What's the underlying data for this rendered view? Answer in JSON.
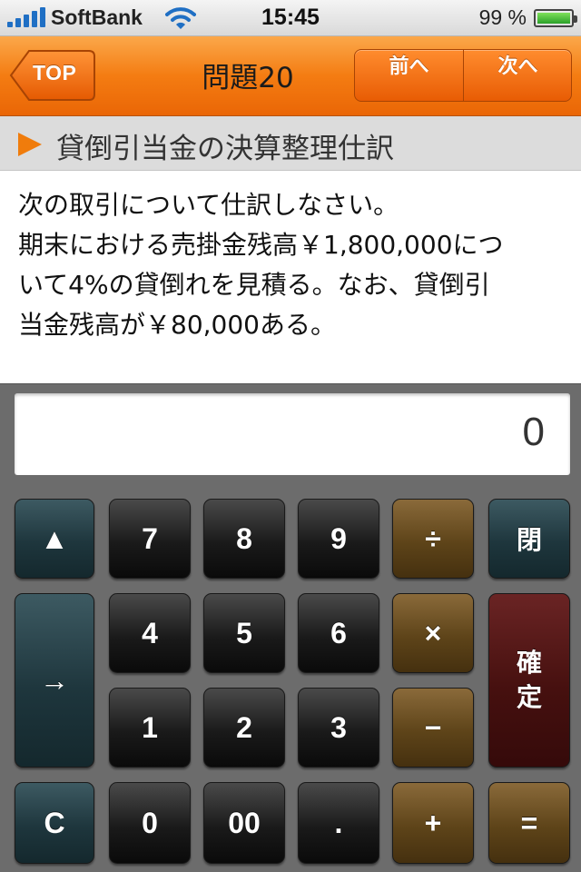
{
  "status_bar": {
    "carrier": "SoftBank",
    "time": "15:45",
    "battery": "99 %",
    "battery_level": 0.99
  },
  "nav": {
    "back_label": "TOP",
    "title": "問題20",
    "prev_label": "前へ",
    "next_label": "次へ"
  },
  "section": {
    "title": "貸倒引当金の決算整理仕訳"
  },
  "question": {
    "lines": [
      "次の取引について仕訳しなさい。",
      "期末における売掛金残高￥1,800,000につ",
      "いて4%の貸倒れを見積る。なお、貸倒引",
      "当金残高が￥80,000ある。"
    ]
  },
  "calculator": {
    "display": "0",
    "keys": {
      "up": "▲",
      "seven": "7",
      "eight": "8",
      "nine": "9",
      "divide": "÷",
      "close": "閉",
      "right": "→",
      "four": "4",
      "five": "5",
      "six": "6",
      "multiply": "×",
      "confirm": "確定",
      "one": "1",
      "two": "2",
      "three": "3",
      "minus": "−",
      "clear": "C",
      "zero": "0",
      "double_zero": "00",
      "decimal": ".",
      "plus": "+",
      "equals": "="
    }
  },
  "colors": {
    "accent": "#f47c12",
    "section_marker": "#f07c0c",
    "calc_background": "#6c6c6c"
  }
}
